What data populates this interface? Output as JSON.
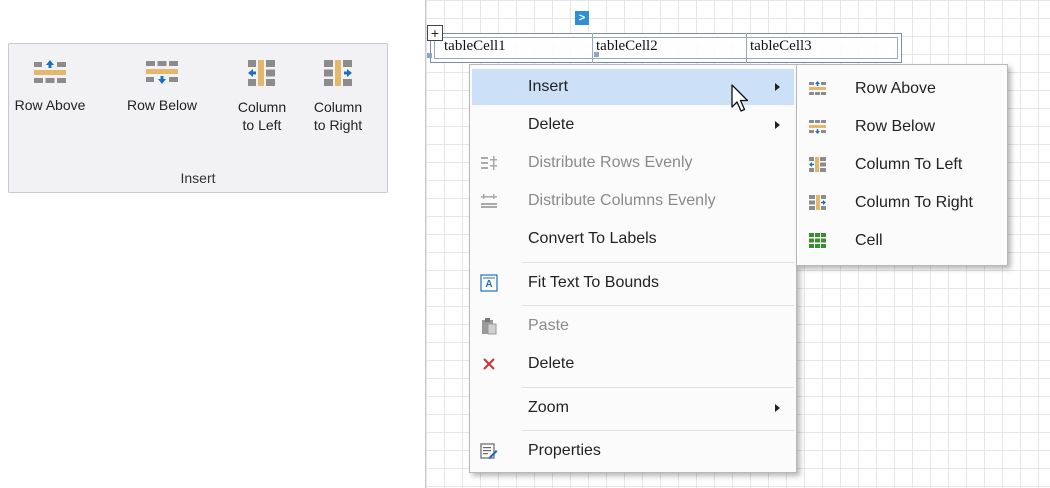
{
  "ribbon": {
    "group_label": "Insert",
    "buttons": [
      {
        "label": "Row Above",
        "icon": "row-above-icon"
      },
      {
        "label": "Row Below",
        "icon": "row-below-icon"
      },
      {
        "label": "Column to Left",
        "icon": "column-left-icon"
      },
      {
        "label": "Column to Right",
        "icon": "column-right-icon"
      }
    ]
  },
  "table": {
    "cells": [
      "tableCell1",
      "tableCell2",
      "tableCell3"
    ],
    "smart_tag_glyph": ">",
    "move_handle_glyph": "+"
  },
  "context_menu": {
    "items": [
      {
        "label": "Insert",
        "submenu": true,
        "highlighted": true
      },
      {
        "label": "Delete",
        "submenu": true
      },
      {
        "label": "Distribute Rows Evenly",
        "disabled": true,
        "icon": "distribute-rows-icon"
      },
      {
        "label": "Distribute Columns Evenly",
        "disabled": true,
        "icon": "distribute-columns-icon"
      },
      {
        "label": "Convert To Labels"
      },
      {
        "label": "Fit Text To Bounds",
        "icon": "fit-text-icon"
      },
      {
        "label": "Paste",
        "disabled": true,
        "icon": "paste-icon"
      },
      {
        "label": "Delete",
        "icon": "delete-x-icon"
      },
      {
        "label": "Zoom",
        "submenu": true
      },
      {
        "label": "Properties",
        "icon": "properties-icon"
      }
    ]
  },
  "insert_submenu": {
    "items": [
      {
        "label": "Row Above",
        "icon": "row-above-icon"
      },
      {
        "label": "Row Below",
        "icon": "row-below-icon"
      },
      {
        "label": "Column To Left",
        "icon": "column-left-icon"
      },
      {
        "label": "Column To Right",
        "icon": "column-right-icon"
      },
      {
        "label": "Cell",
        "icon": "cell-icon"
      }
    ]
  },
  "colors": {
    "accent_blue": "#1e6fc4",
    "row_highlight": "#e4b76a",
    "grid_gray": "#8c8c8c",
    "menu_highlight": "#cce1f7",
    "cell_green": "#3c8c32",
    "delete_red": "#c43c3c"
  }
}
